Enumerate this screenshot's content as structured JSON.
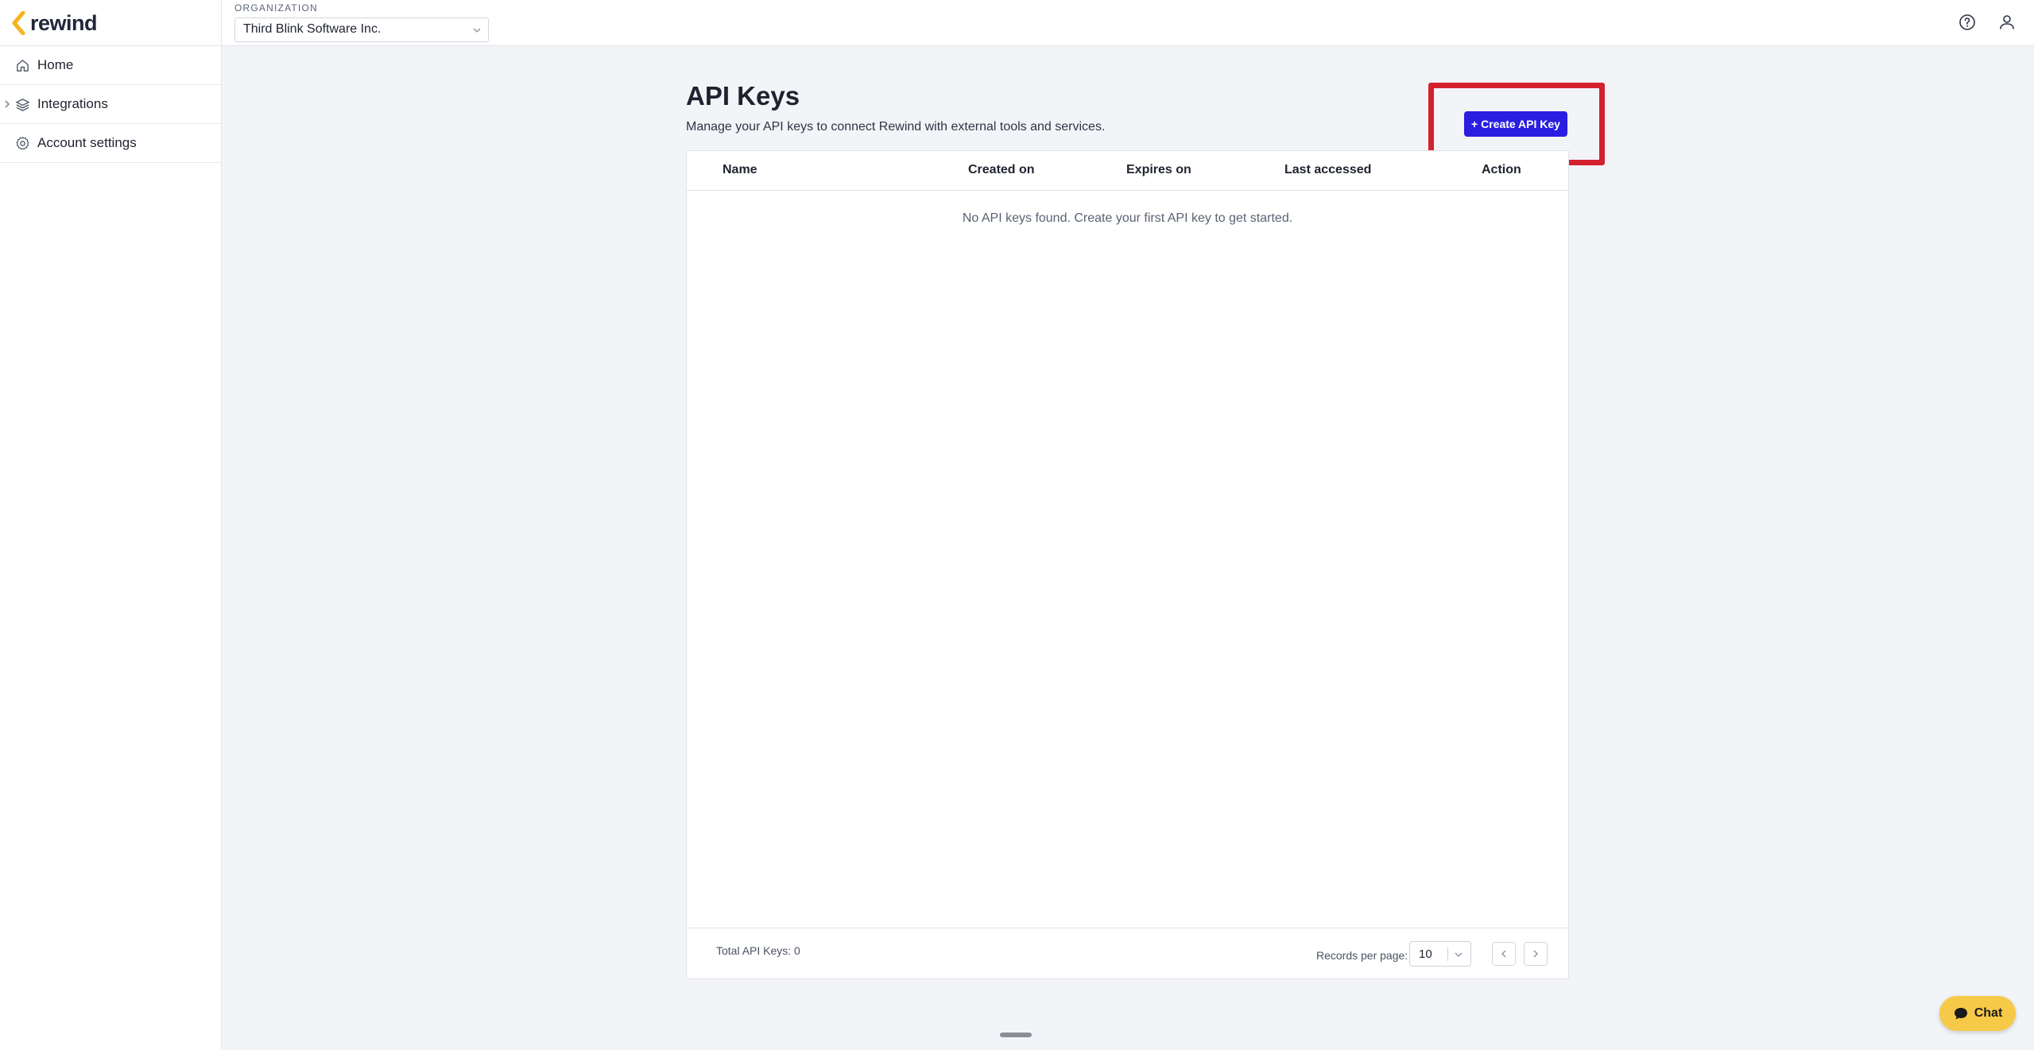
{
  "brand": {
    "name": "rewind",
    "accent_color": "#f4b41a",
    "primary_color": "#2a1ee0",
    "highlight_color": "#d3212f"
  },
  "header": {
    "org_label": "ORGANIZATION",
    "org_selected": "Third Blink Software Inc.",
    "help_icon": "help-circle-icon",
    "user_icon": "user-icon"
  },
  "sidebar": {
    "items": [
      {
        "label": "Home",
        "icon": "home-icon"
      },
      {
        "label": "Integrations",
        "icon": "layers-icon",
        "expandable": true
      },
      {
        "label": "Account settings",
        "icon": "gear-icon"
      }
    ]
  },
  "main": {
    "title": "API Keys",
    "subtitle": "Manage your API keys to connect Rewind with external tools and services.",
    "create_button_label": "+ Create API Key",
    "table": {
      "columns": [
        "Name",
        "Created on",
        "Expires on",
        "Last accessed",
        "Action"
      ],
      "rows": [],
      "empty_message": "No API keys found. Create your first API key to get started."
    },
    "footer": {
      "total_label": "Total API Keys: 0",
      "records_per_page_label": "Records per page:",
      "records_per_page_value": "10"
    }
  },
  "chat": {
    "label": "Chat"
  }
}
